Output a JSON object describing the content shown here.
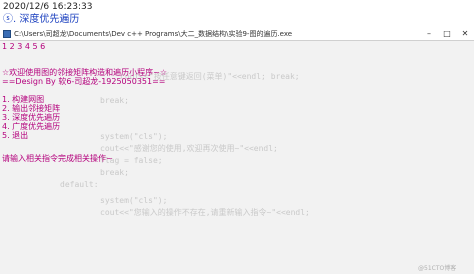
{
  "article": {
    "timestamp": "2020/12/6 16:23:33",
    "title": "ⓢ. 深度优先遍历"
  },
  "window": {
    "title": "C:\\Users\\司超龙\\Documents\\Dev c++ Programs\\大二_数据结构\\实验9-图的遍历.exe",
    "minimize": "–",
    "maximize": "□",
    "close": "✕"
  },
  "console": {
    "numbers": "1 2 3 4 5 6",
    "welcome": "☆欢迎使用图的邻接矩阵构造和遍历小程序~☆",
    "design": "==Design By 软6-司超龙-1925050351==",
    "menu": [
      "1. 构建网图",
      "2. 输出邻接矩阵",
      "3. 深度优先遍历",
      "4. 广度优先遍历",
      "5. 退出"
    ],
    "prompt": "请输入相关指令完成相关操作~"
  },
  "background_code": [
    "cout<<\"按任意键返回(菜单)\"<<endl; break;",
    "break;",
    "system(\"cls\");",
    "cout<<\"感谢您的使用,欢迎再次使用~\"<<endl;",
    "flag = false;",
    "break;",
    "default:",
    "system(\"cls\");",
    "cout<<\"您输入的操作不存在,请重新输入指令~\"<<endl;"
  ],
  "watermark": "@51CTO博客"
}
